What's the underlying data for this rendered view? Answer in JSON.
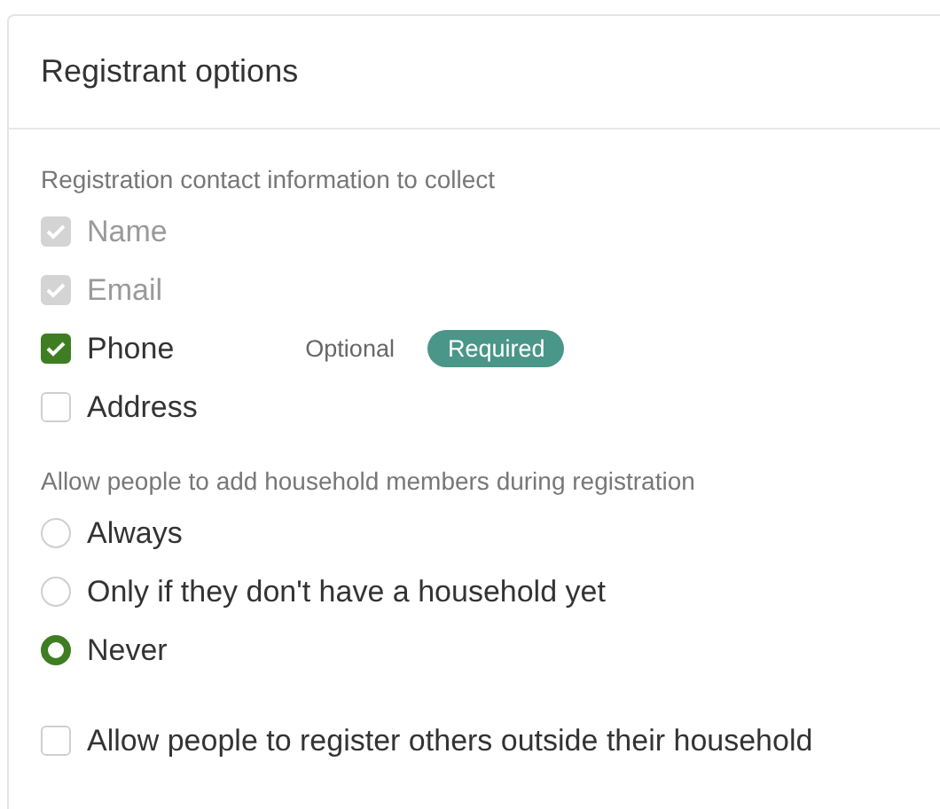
{
  "card": {
    "title": "Registrant options"
  },
  "contact_section": {
    "label": "Registration contact information to collect",
    "fields": [
      {
        "label": "Name",
        "checked": true,
        "disabled": true
      },
      {
        "label": "Email",
        "checked": true,
        "disabled": true
      },
      {
        "label": "Phone",
        "checked": true,
        "disabled": false,
        "requirement": [
          {
            "label": "Optional",
            "selected": false
          },
          {
            "label": "Required",
            "selected": true
          }
        ]
      },
      {
        "label": "Address",
        "checked": false,
        "disabled": false
      }
    ]
  },
  "household_section": {
    "label": "Allow people to add household members during registration",
    "options": [
      {
        "label": "Always",
        "selected": false
      },
      {
        "label": "Only if they don't have a household yet",
        "selected": false
      },
      {
        "label": "Never",
        "selected": true
      }
    ]
  },
  "register_others": {
    "label": "Allow people to register others outside their household",
    "checked": false
  }
}
